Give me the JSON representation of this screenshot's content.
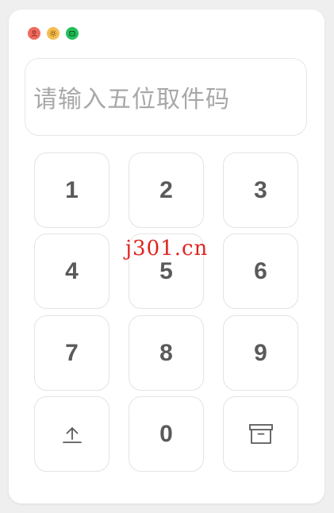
{
  "input": {
    "placeholder": "请输入五位取件码"
  },
  "keypad": {
    "keys": [
      "1",
      "2",
      "3",
      "4",
      "5",
      "6",
      "7",
      "8",
      "9",
      "0"
    ],
    "upload_icon": "upload-icon",
    "archive_icon": "archive-box-icon"
  },
  "watermark": "j301.cn",
  "colors": {
    "close": "#ee6a5f",
    "minimize": "#f5be4f",
    "maximize": "#24c05a",
    "watermark": "#e0241f",
    "key_text": "#5a5a5a",
    "placeholder": "#a8a8a8"
  }
}
